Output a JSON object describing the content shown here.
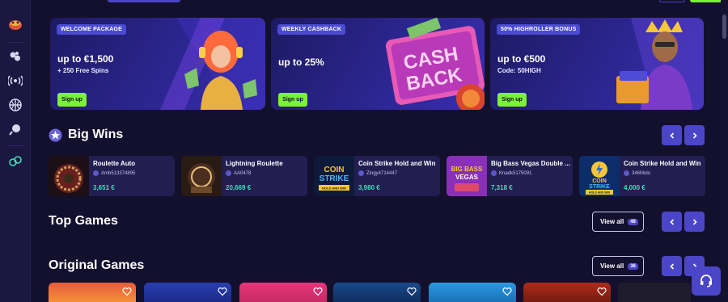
{
  "promos": [
    {
      "tag": "WELCOME PACKAGE",
      "headline": "up to €1,500",
      "sub": "+ 250 Free Spins",
      "button": "Sign up"
    },
    {
      "tag": "WEEKLY CASHBACK",
      "headline": "up to 25%",
      "sub": "",
      "button": "Sign up",
      "art_text": [
        "CASH",
        "BACK"
      ]
    },
    {
      "tag": "50% HIGHROLLER BONUS",
      "headline": "up to €500",
      "sub": "Code: 50HIGH",
      "button": "Sign up"
    }
  ],
  "big_wins": {
    "title": "Big Wins",
    "cards": [
      {
        "game": "Roulette Auto",
        "user": "Amb513374895",
        "amount": "3,651 €"
      },
      {
        "game": "Lightning Roulette",
        "user": "AA0478",
        "amount": "20,669 €"
      },
      {
        "game": "Coin Strike Hold and Win",
        "user": "Zingy4714447",
        "amount": "3,980 €",
        "thumb_text": [
          "COIN",
          "STRIKE",
          "HOLD AND WIN"
        ]
      },
      {
        "game": "Big Bass Vegas Double ...",
        "user": "Knadk5175091",
        "amount": "7,318 €",
        "thumb_text": [
          "BIG BASS",
          "VEGAS"
        ]
      },
      {
        "game": "Coin Strike Hold and Win",
        "user": "346Molo",
        "amount": "4,000 €",
        "thumb_text": [
          "COIN",
          "STRIKE",
          "HOLD AND WIN"
        ]
      }
    ]
  },
  "top_games": {
    "title": "Top Games",
    "view_all": "View all",
    "count": "48"
  },
  "original_games": {
    "title": "Original Games",
    "view_all": "View all",
    "count": "36"
  },
  "colors": {
    "accent": "#4b46c8",
    "cta": "#7cf13b",
    "amount": "#3fe0b5",
    "background": "#13102e"
  }
}
